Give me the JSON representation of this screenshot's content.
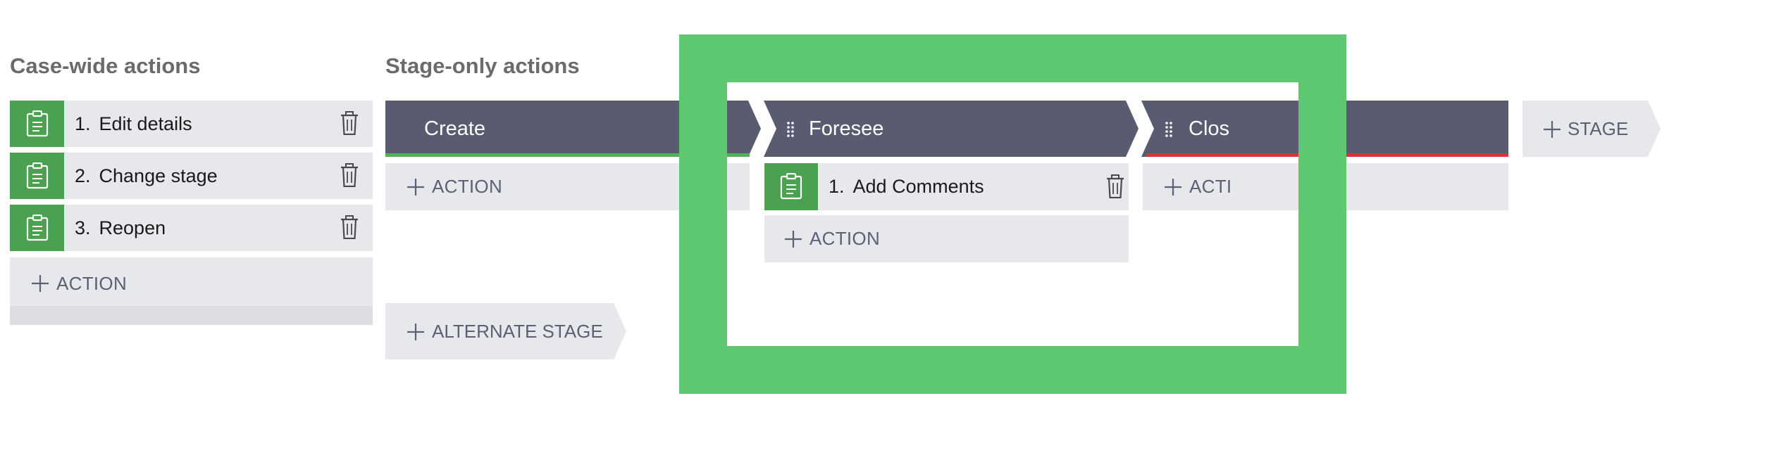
{
  "case_wide": {
    "title": "Case-wide actions",
    "steps": [
      {
        "num": "1.",
        "label": "Edit details"
      },
      {
        "num": "2.",
        "label": "Change stage"
      },
      {
        "num": "3.",
        "label": "Reopen"
      }
    ],
    "add_action_label": "ACTION"
  },
  "stage_only": {
    "title": "Stage-only actions",
    "stages": [
      {
        "name": "Create",
        "add_action_label": "ACTION"
      },
      {
        "name": "Foresee",
        "steps": [
          {
            "num": "1.",
            "label": "Add Comments"
          }
        ],
        "add_action_label": "ACTION"
      },
      {
        "name": "Clos",
        "add_action_label": "ACTI"
      }
    ],
    "add_stage_label": "STAGE",
    "add_alternate_stage_label": "ALTERNATE STAGE"
  },
  "colors": {
    "stage_bar": "#595c70",
    "step_icon": "#4aa14f",
    "highlight_frame": "#5dc86f",
    "create_underline": "#4fb35a",
    "close_underline": "#d6363a"
  },
  "icons": {
    "step": "clipboard-icon",
    "delete": "trash-icon",
    "add": "plus-icon",
    "drag": "drag-handle-icon"
  }
}
